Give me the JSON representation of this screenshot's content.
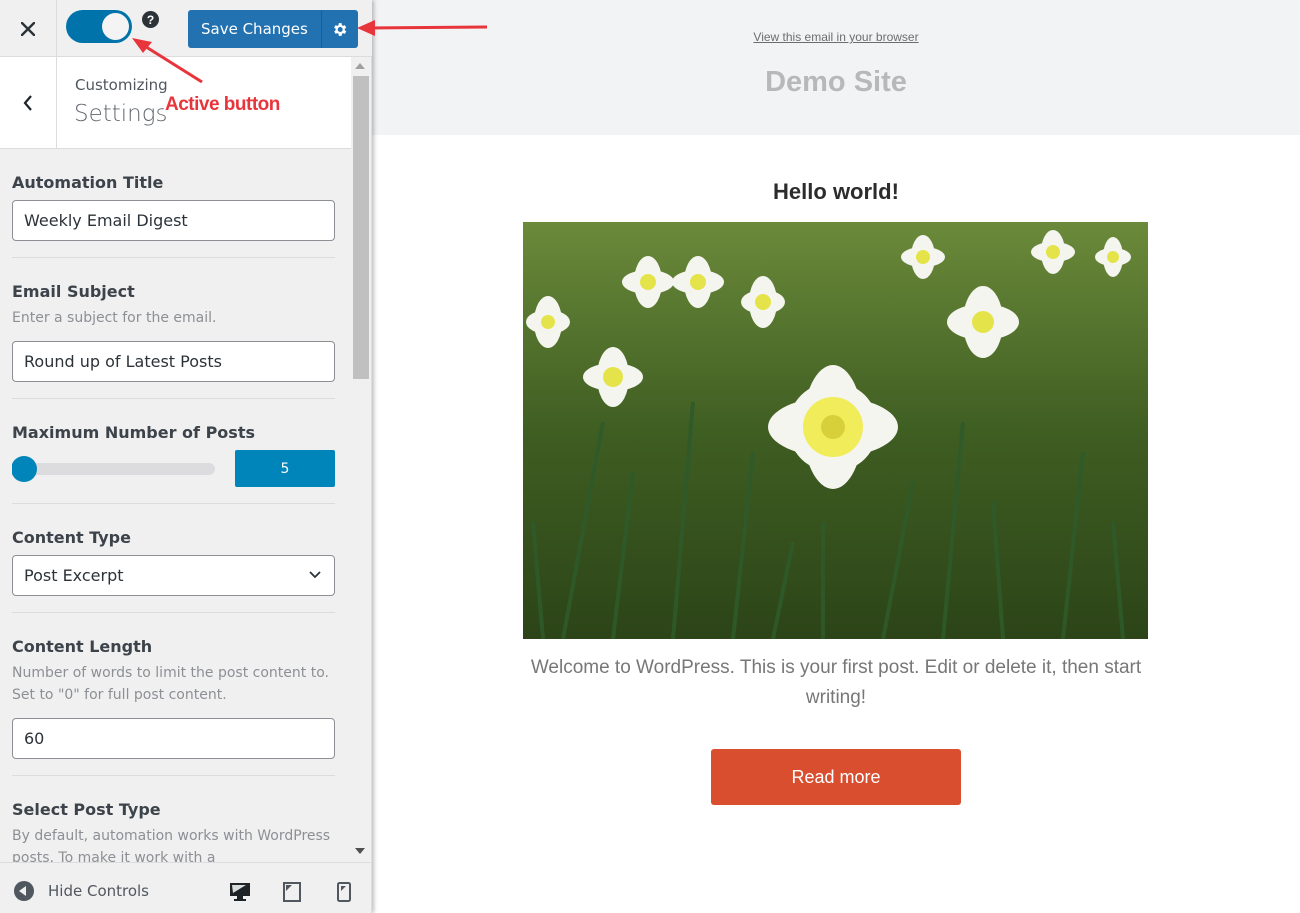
{
  "topbar": {
    "close_icon": "close-icon",
    "toggle": {
      "state": "on",
      "label": "Active"
    },
    "help_icon_glyph": "?",
    "save_label": "Save Changes",
    "settings_icon": "gear-icon"
  },
  "section": {
    "back_icon": "chevron-left-icon",
    "customizing_label": "Customizing",
    "title": "Settings"
  },
  "controls": {
    "automation_title": {
      "label": "Automation Title",
      "value": "Weekly Email Digest"
    },
    "email_subject": {
      "label": "Email Subject",
      "description": "Enter a subject for the email.",
      "value": "Round up of Latest Posts"
    },
    "max_posts": {
      "label": "Maximum Number of Posts",
      "value": "5",
      "slider_fraction": 0.0
    },
    "content_type": {
      "label": "Content Type",
      "selected": "Post Excerpt"
    },
    "content_length": {
      "label": "Content Length",
      "description": "Number of words to limit the post content to. Set to \"0\" for full post content.",
      "value": "60"
    },
    "post_type": {
      "label": "Select Post Type",
      "description": "By default, automation works with WordPress posts. To make it work with a"
    }
  },
  "footer": {
    "hide_controls_label": "Hide Controls",
    "devices": [
      "desktop",
      "tablet",
      "mobile"
    ],
    "active_device": "desktop"
  },
  "preview": {
    "view_in_browser": "View this email in your browser",
    "site_name": "Demo Site",
    "post_title": "Hello world!",
    "post_image_alt": "White daffodils with yellow centers in green grass",
    "excerpt": "Welcome to WordPress. This is your first post. Edit or delete it, then start writing!",
    "read_more": "Read more"
  },
  "annotations": {
    "toggle_callout": "Active button"
  },
  "colors": {
    "accent": "#2271b1",
    "toggle": "#0073aa",
    "slider": "#0085ba",
    "read_more": "#d94e2f",
    "annotation": "#e8353b"
  }
}
